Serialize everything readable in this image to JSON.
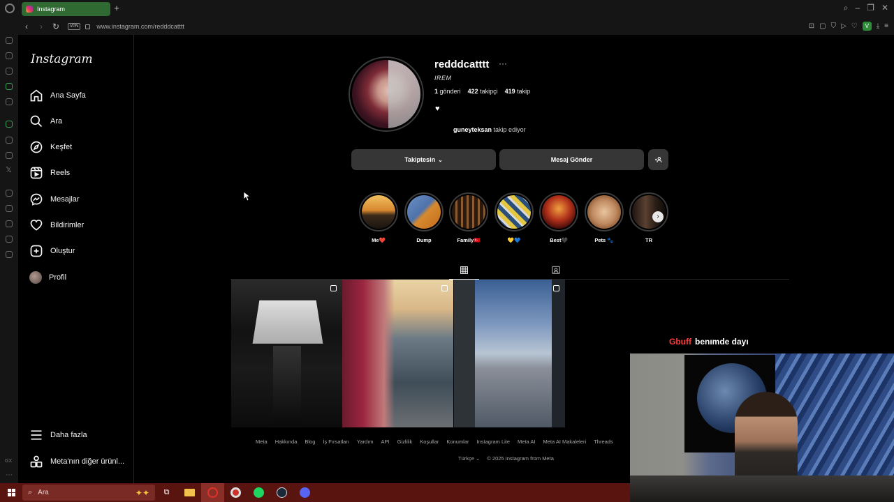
{
  "browser": {
    "tab_title": "Instagram",
    "new_tab_label": "+",
    "url": "www.instagram.com/redddcatttt",
    "vpn_label": "VPN",
    "profile_letter": "V",
    "gx_label": "GX"
  },
  "sidebar": {
    "logo": "Instagram",
    "items": [
      {
        "label": "Ana Sayfa",
        "icon": "home-icon"
      },
      {
        "label": "Ara",
        "icon": "search-icon"
      },
      {
        "label": "Keşfet",
        "icon": "compass-icon"
      },
      {
        "label": "Reels",
        "icon": "reels-icon"
      },
      {
        "label": "Mesajlar",
        "icon": "messenger-icon"
      },
      {
        "label": "Bildirimler",
        "icon": "heart-icon"
      },
      {
        "label": "Oluştur",
        "icon": "plus-square-icon"
      },
      {
        "label": "Profil",
        "icon": "avatar"
      }
    ],
    "more_label": "Daha fazla",
    "meta_label": "Meta'nın diğer ürünl..."
  },
  "profile": {
    "username": "redddcatttt",
    "full_name": "IREM",
    "posts_count": "1",
    "posts_label": "gönderi",
    "followers_count": "422",
    "followers_label": "takipçi",
    "following_count": "419",
    "following_label": "takip",
    "bio": "♥",
    "followed_by_user": "guneyteksan",
    "followed_by_text": "takip ediyor",
    "following_button": "Takiptesin",
    "message_button": "Mesaj Gönder"
  },
  "highlights": [
    {
      "label": "Me❤️"
    },
    {
      "label": "Dump"
    },
    {
      "label": "Family🇹🇷"
    },
    {
      "label": "💛💙"
    },
    {
      "label": "Best🖤"
    },
    {
      "label": "Pets 🐾"
    },
    {
      "label": "TR"
    }
  ],
  "footer": {
    "links": [
      "Meta",
      "Hakkında",
      "Blog",
      "İş Fırsatları",
      "Yardım",
      "API",
      "Gizlilik",
      "Koşullar",
      "Konumlar",
      "Instagram Lite",
      "Meta AI",
      "Meta AI Makaleleri",
      "Threads"
    ],
    "language": "Türkçe",
    "copyright": "© 2025 Instagram from Meta"
  },
  "stream": {
    "chat_user": "Gbuff",
    "chat_message": "benımde dayı"
  },
  "taskbar": {
    "search_placeholder": "Ara"
  },
  "colors": {
    "tab_active": "#2e6a32",
    "taskbar": "#5a1410",
    "button_bg": "#363636",
    "chat_user": "#ff3b3b"
  }
}
